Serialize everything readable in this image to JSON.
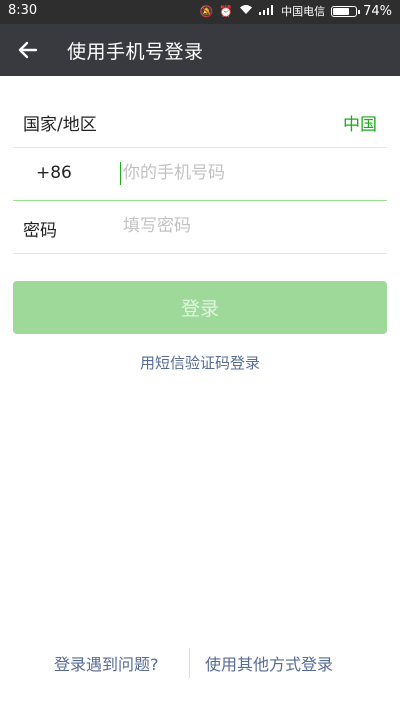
{
  "status_bar": {
    "time": "8:30",
    "carrier": "中国电信",
    "battery": "74%",
    "battery_level": 0.74
  },
  "header": {
    "title": "使用手机号登录"
  },
  "form": {
    "region_label": "国家/地区",
    "region_value": "中国",
    "country_code": "+86",
    "phone_placeholder": "你的手机号码",
    "password_label": "密码",
    "password_placeholder": "填写密码"
  },
  "actions": {
    "login_label": "登录",
    "sms_login_label": "用短信验证码登录",
    "login_problem_label": "登录遇到问题?",
    "other_methods_label": "使用其他方式登录"
  },
  "colors": {
    "accent_green": "#1aad19",
    "button_disabled": "#9ed99a",
    "link_blue": "#576b95",
    "appbar": "#393a3f"
  }
}
